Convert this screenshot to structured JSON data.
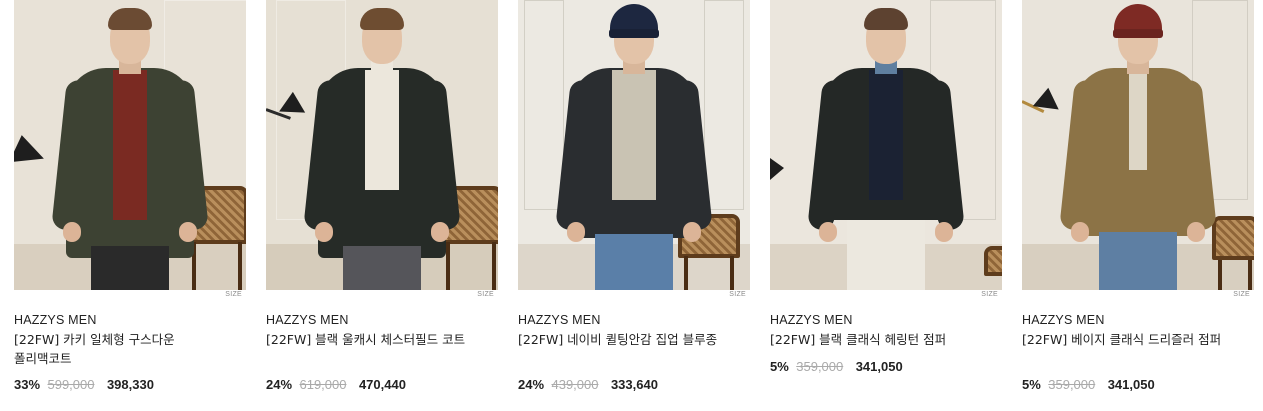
{
  "products": [
    {
      "brand": "HAZZYS MEN",
      "name": "[22FW] 카키 일체형 구스다운 폴리맥코트",
      "discount": "33%",
      "original_price": "599,000",
      "sale_price": "398,330",
      "size_label": "SIZE",
      "colors": {
        "wall": "#e8e2d7",
        "coat": "#3d4233",
        "inner": "#7a2a22",
        "hair": "#6b4b33"
      }
    },
    {
      "brand": "HAZZYS MEN",
      "name": "[22FW] 블랙 울캐시 체스터필드 코트",
      "discount": "24%",
      "original_price": "619,000",
      "sale_price": "470,440",
      "size_label": "SIZE",
      "colors": {
        "wall": "#e6e0d4",
        "coat": "#262b27",
        "inner": "#ece7dc",
        "hair": "#6e4d31"
      }
    },
    {
      "brand": "HAZZYS MEN",
      "name": "[22FW] 네이비 퀼팅안감 집업 블루종",
      "discount": "24%",
      "original_price": "439,000",
      "sale_price": "333,640",
      "size_label": "SIZE",
      "colors": {
        "wall": "#ece9e2",
        "coat": "#2a2d30",
        "inner": "#c9c3b3",
        "hair": "#1d2740"
      }
    },
    {
      "brand": "HAZZYS MEN",
      "name": "[22FW] 블랙 클래식 헤링턴 점퍼",
      "discount": "5%",
      "original_price": "359,000",
      "sale_price": "341,050",
      "size_label": "SIZE",
      "colors": {
        "wall": "#ebe6dd",
        "coat": "#242826",
        "inner": "#1b2233",
        "hair": "#5d4230"
      }
    },
    {
      "brand": "HAZZYS MEN",
      "name": "[22FW] 베이지 클래식 드리즐러 점퍼",
      "discount": "5%",
      "original_price": "359,000",
      "sale_price": "341,050",
      "size_label": "SIZE",
      "colors": {
        "wall": "#e9e4db",
        "coat": "#8c7346",
        "inner": "#ddd6c6",
        "hair": "#7e2a24"
      }
    }
  ]
}
